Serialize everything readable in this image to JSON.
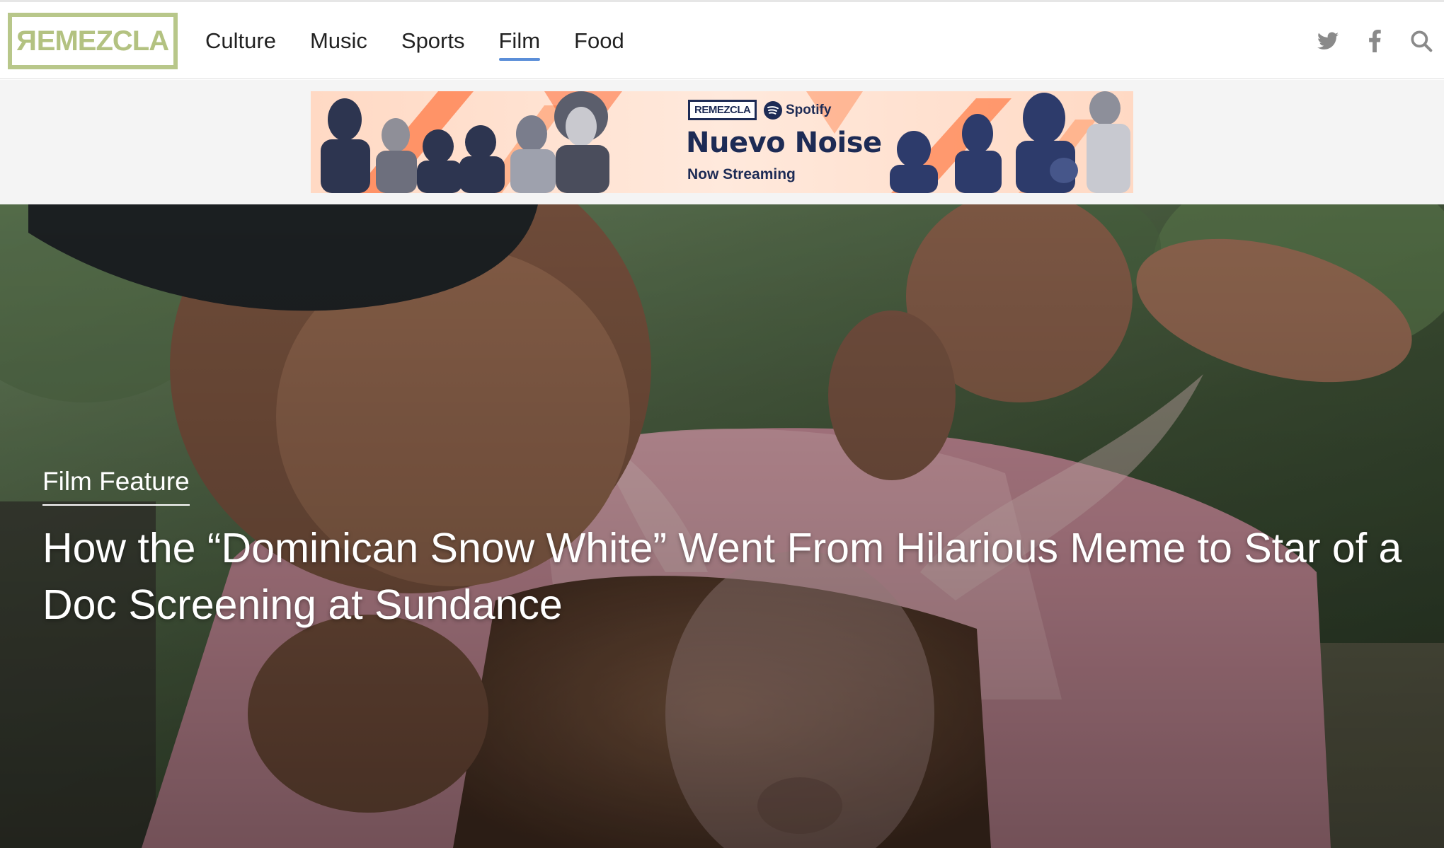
{
  "brand": {
    "name": "REMEZCLA",
    "accent": "#b8c78a"
  },
  "nav": {
    "items": [
      {
        "label": "Culture"
      },
      {
        "label": "Music"
      },
      {
        "label": "Sports"
      },
      {
        "label": "Film",
        "active": true
      },
      {
        "label": "Food"
      }
    ],
    "active_color": "#5b8ed8"
  },
  "header_icons": [
    "twitter-icon",
    "facebook-icon",
    "search-icon"
  ],
  "ad": {
    "brand_logo": "REMEZCLA",
    "partner": "Spotify",
    "title": "Nuevo Noise",
    "subtitle": "Now Streaming"
  },
  "hero": {
    "kicker": "Film Feature",
    "headline": "How the “Dominican Snow White” Went From Hilarious Meme to Star of a Doc Screening at Sundance"
  }
}
